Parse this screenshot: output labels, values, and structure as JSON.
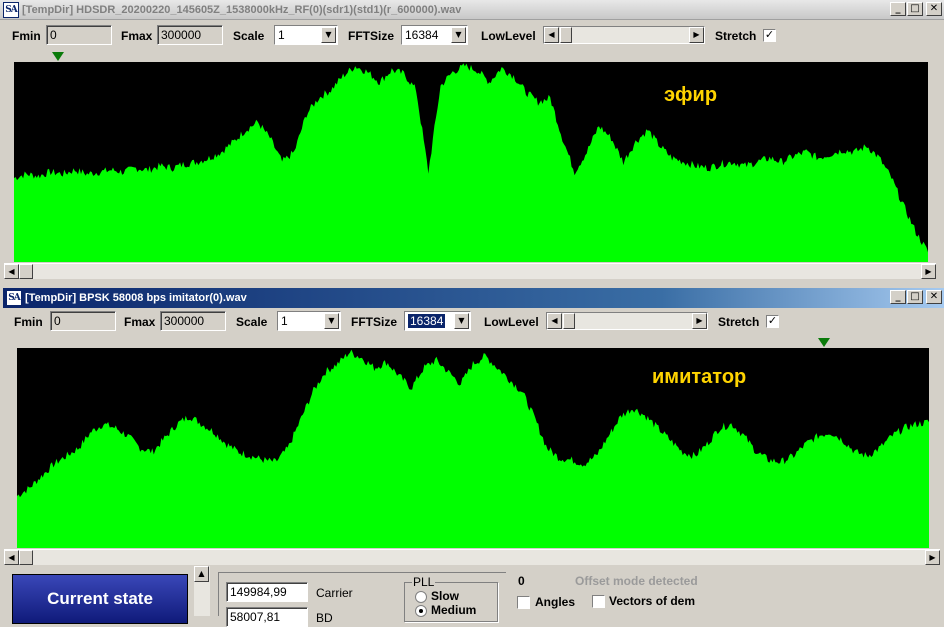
{
  "window1": {
    "title": "[TempDir] HDSDR_20200220_145605Z_1538000kHz_RF(0)(sdr1)(std1)(r_600000).wav",
    "fmin_label": "Fmin",
    "fmin_value": "0",
    "fmax_label": "Fmax",
    "fmax_value": "300000",
    "scale_label": "Scale",
    "scale_value": "1",
    "fftsize_label": "FFTSize",
    "fftsize_value": "16384",
    "lowlevel_label": "LowLevel",
    "stretch_label": "Stretch",
    "stretch_checked": true,
    "overlay_label": "эфир"
  },
  "window2": {
    "title": "[TempDir] BPSK 58008 bps imitator(0).wav",
    "fmin_label": "Fmin",
    "fmin_value": "0",
    "fmax_label": "Fmax",
    "fmax_value": "300000",
    "scale_label": "Scale",
    "scale_value": "1",
    "fftsize_label": "FFTSize",
    "fftsize_value": "16384",
    "lowlevel_label": "LowLevel",
    "stretch_label": "Stretch",
    "stretch_checked": true,
    "overlay_label": "имитатор"
  },
  "window_buttons": {
    "minimize": "_",
    "maximize": "□",
    "close": "✕"
  },
  "bottom": {
    "current_state": "Current state",
    "carrier_value": "149984,99",
    "carrier_label": "Carrier",
    "bd_value": "58007,81",
    "bd_label": "BD",
    "pll_group": "PLL",
    "pll_slow": "Slow",
    "pll_medium": "Medium",
    "counter": "0",
    "offset_status": "Offset mode detected",
    "angles_label": "Angles",
    "vectors_label": "Vectors of dem"
  },
  "icons": {
    "app": "SA",
    "checkmark": "✓",
    "arrow_down": "▼",
    "arrow_left": "◀",
    "arrow_right": "▶",
    "arrow_up": "▲"
  },
  "colors": {
    "spectrum": "#00ff00",
    "spectrum_bg": "#000000",
    "label": "#ffd400",
    "marker": "#0a7a0a"
  },
  "chart_data": [
    {
      "type": "area",
      "series": [
        {
          "name": "эфир",
          "values": [
            0.42,
            0.44,
            0.43,
            0.45,
            0.44,
            0.46,
            0.44,
            0.45,
            0.46,
            0.45,
            0.47,
            0.46,
            0.48,
            0.47,
            0.49,
            0.5,
            0.52,
            0.55,
            0.6,
            0.66,
            0.7,
            0.62,
            0.5,
            0.55,
            0.74,
            0.82,
            0.86,
            0.93,
            0.98,
            0.95,
            0.9,
            0.96,
            0.94,
            0.86,
            0.45,
            0.88,
            0.95,
            0.98,
            0.96,
            0.9,
            0.97,
            0.93,
            0.85,
            0.8,
            0.82,
            0.62,
            0.45,
            0.55,
            0.68,
            0.62,
            0.5,
            0.6,
            0.66,
            0.58,
            0.52,
            0.5,
            0.48,
            0.47,
            0.49,
            0.5,
            0.48,
            0.5,
            0.52,
            0.5,
            0.53,
            0.55,
            0.52,
            0.54,
            0.56,
            0.55,
            0.58,
            0.52,
            0.42,
            0.28,
            0.15,
            0.05
          ]
        }
      ]
    },
    {
      "type": "area",
      "series": [
        {
          "name": "имитатор",
          "values": [
            0.26,
            0.3,
            0.36,
            0.42,
            0.46,
            0.5,
            0.58,
            0.62,
            0.6,
            0.56,
            0.5,
            0.48,
            0.55,
            0.62,
            0.66,
            0.62,
            0.58,
            0.52,
            0.48,
            0.46,
            0.44,
            0.43,
            0.5,
            0.64,
            0.78,
            0.88,
            0.92,
            0.98,
            0.95,
            0.9,
            0.93,
            0.86,
            0.8,
            0.9,
            0.94,
            0.88,
            0.82,
            0.92,
            0.96,
            0.9,
            0.84,
            0.78,
            0.65,
            0.5,
            0.45,
            0.44,
            0.42,
            0.46,
            0.56,
            0.66,
            0.7,
            0.66,
            0.6,
            0.54,
            0.48,
            0.46,
            0.52,
            0.6,
            0.62,
            0.56,
            0.48,
            0.44,
            0.43,
            0.46,
            0.52,
            0.56,
            0.58,
            0.54,
            0.48,
            0.46,
            0.5,
            0.56,
            0.6,
            0.62,
            0.63
          ]
        }
      ]
    }
  ]
}
